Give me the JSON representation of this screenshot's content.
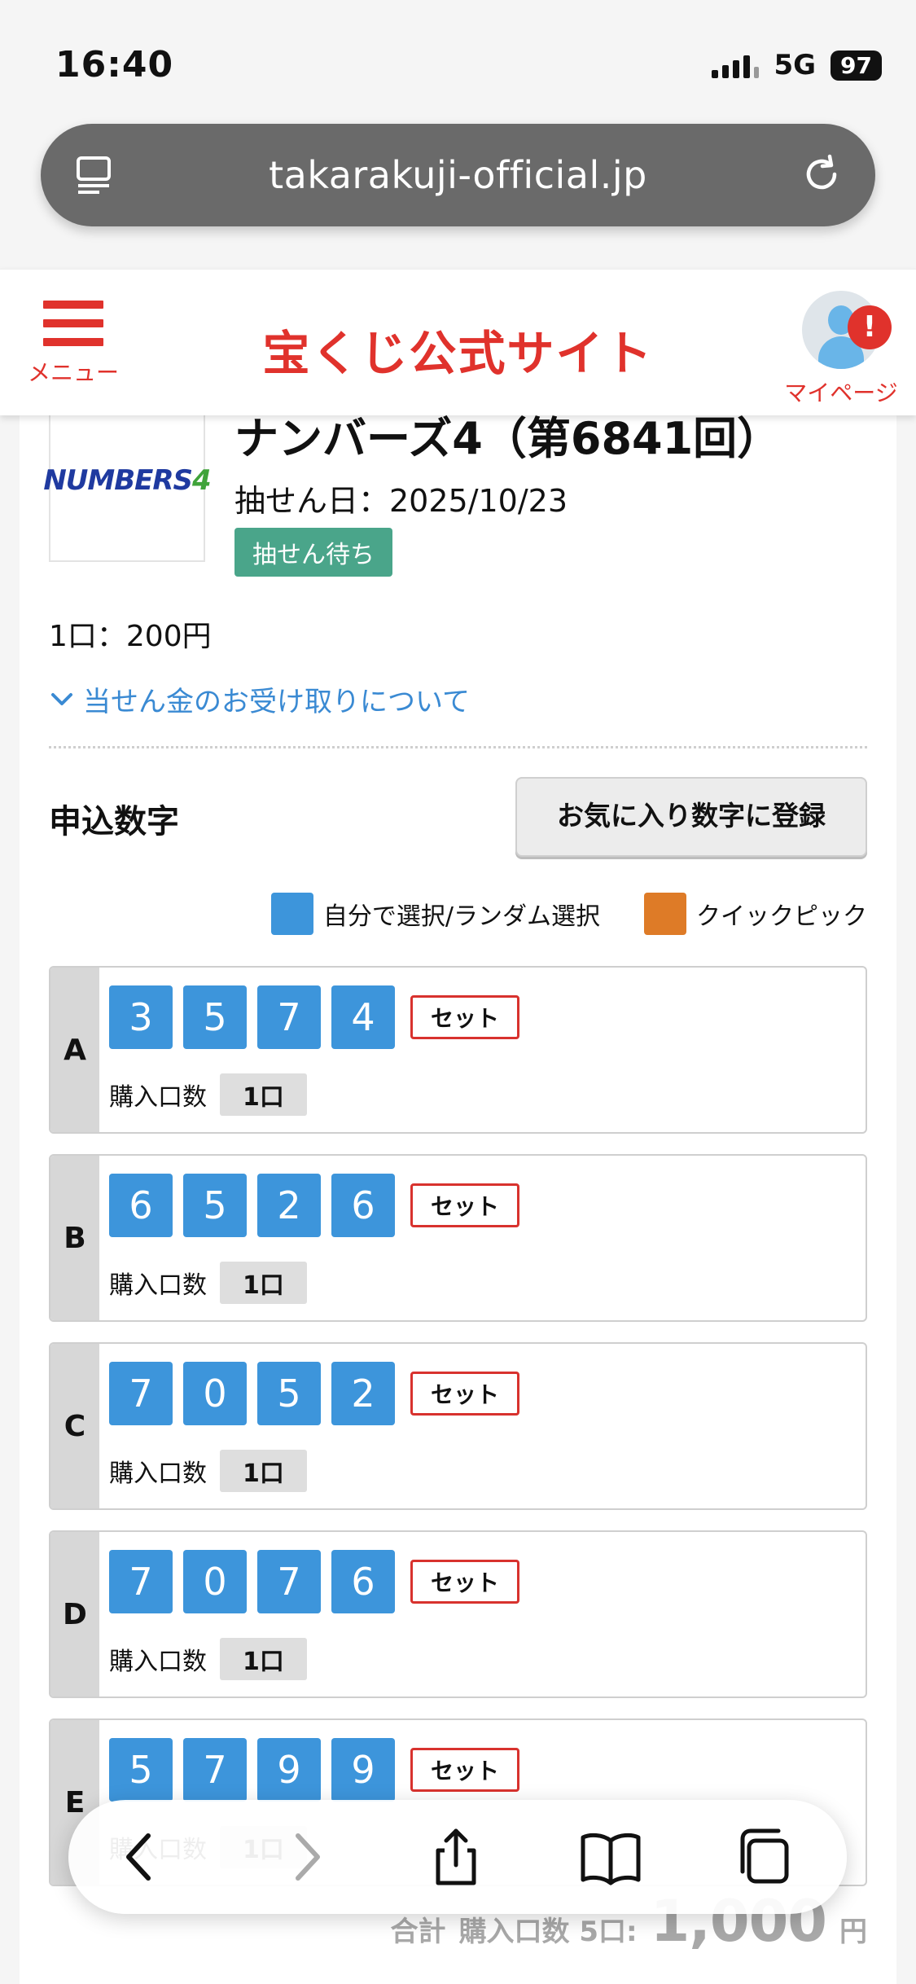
{
  "status_bar": {
    "time": "16:40",
    "network": "5G",
    "battery": "97"
  },
  "browser": {
    "url": "takarakuji-official.jp"
  },
  "header": {
    "menu_label": "メニュー",
    "site_title": "宝くじ公式サイト",
    "mypage_label": "マイページ",
    "alert_badge": "!"
  },
  "product": {
    "logo_text": "NUMBERS",
    "logo_digit": "4",
    "title": "ナンバーズ4（第6841回）",
    "draw_date": "抽せん日：2025/10/23",
    "status": "抽せん待ち",
    "price": "1口：200円",
    "winnings_link": "当せん金のお受け取りについて"
  },
  "entry": {
    "section_title": "申込数字",
    "favorite_button": "お気に入り数字に登録",
    "legend": [
      {
        "label": "自分で選択/ランダム選択",
        "color": "#3d95db"
      },
      {
        "label": "クイックピック",
        "color": "#de7b27"
      }
    ],
    "qty_label": "購入口数",
    "set_label": "セット",
    "rows": [
      {
        "letter": "A",
        "digits": [
          "3",
          "5",
          "7",
          "4"
        ],
        "qty": "1口"
      },
      {
        "letter": "B",
        "digits": [
          "6",
          "5",
          "2",
          "6"
        ],
        "qty": "1口"
      },
      {
        "letter": "C",
        "digits": [
          "7",
          "0",
          "5",
          "2"
        ],
        "qty": "1口"
      },
      {
        "letter": "D",
        "digits": [
          "7",
          "0",
          "7",
          "6"
        ],
        "qty": "1口"
      },
      {
        "letter": "E",
        "digits": [
          "5",
          "7",
          "9",
          "9"
        ],
        "qty": "1口"
      }
    ]
  },
  "total": {
    "label": "合計",
    "qty": "購入口数 5口:",
    "amount": "1,000",
    "unit": "円"
  },
  "colors": {
    "brand_red": "#e0322c",
    "digit_blue": "#3d95db",
    "status_green": "#4aa58a"
  }
}
